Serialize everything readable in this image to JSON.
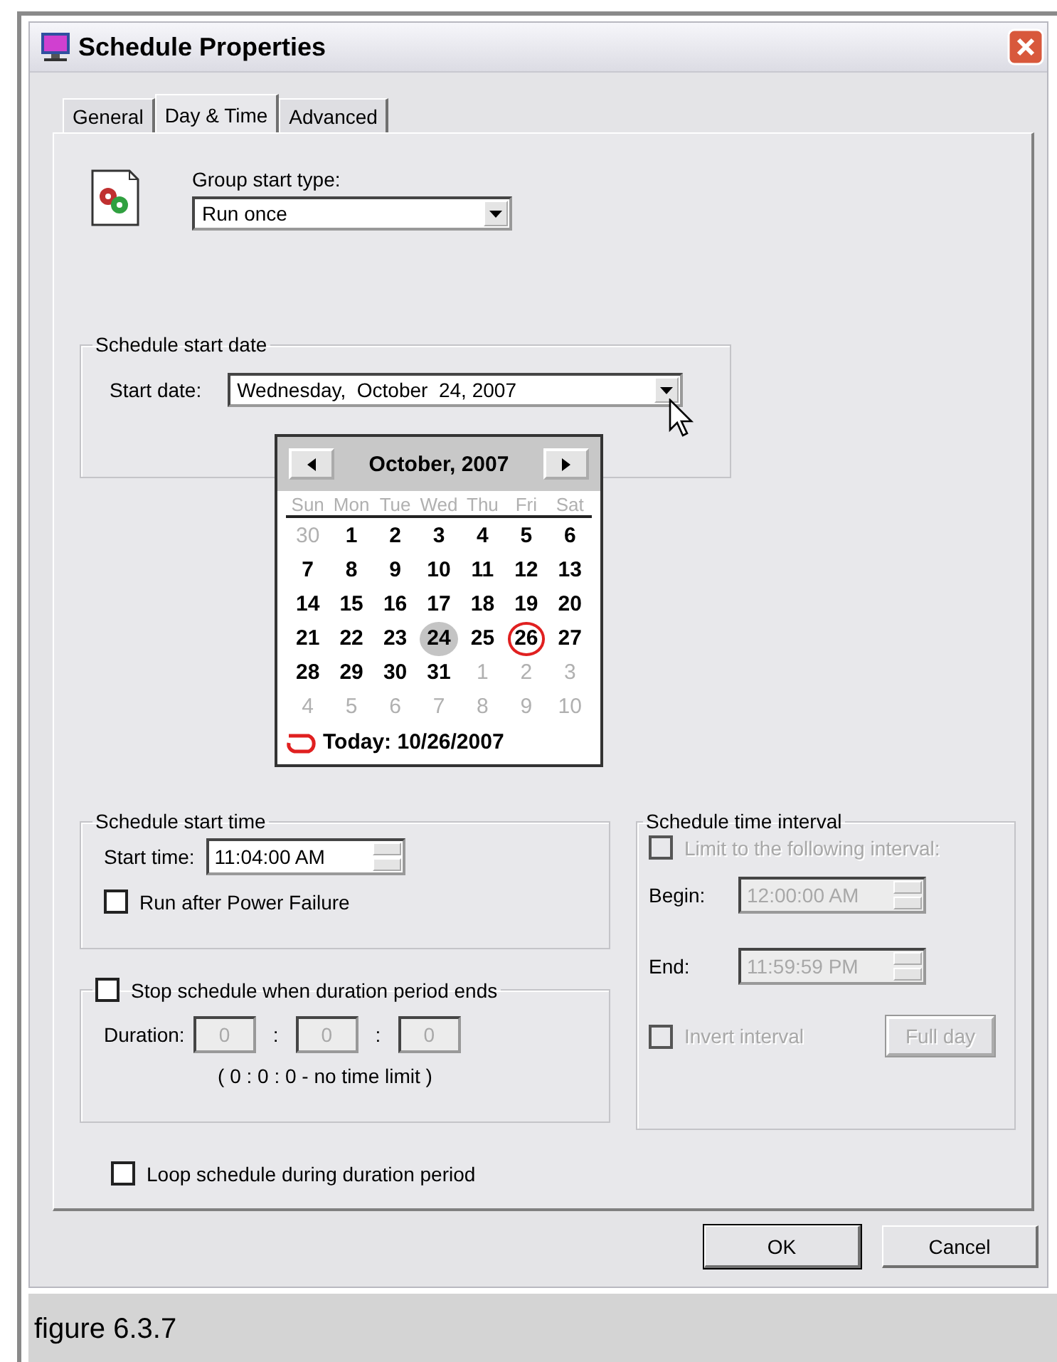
{
  "window": {
    "title": "Schedule Properties"
  },
  "tabs": [
    {
      "label": "General",
      "selected": false
    },
    {
      "label": "Day & Time",
      "selected": true
    },
    {
      "label": "Advanced",
      "selected": false
    }
  ],
  "group_start_type": {
    "label": "Group start type:",
    "value": "Run once"
  },
  "start_date_group": {
    "title": "Schedule start date",
    "label": "Start date:",
    "value": "Wednesday,  October  24, 2007"
  },
  "calendar": {
    "month": "October, 2007",
    "weekdays": [
      "Sun",
      "Mon",
      "Tue",
      "Wed",
      "Thu",
      "Fri",
      "Sat"
    ],
    "weeks": [
      [
        {
          "day": "30",
          "muted": true,
          "selected": false,
          "circled": false
        },
        {
          "day": "1",
          "muted": false,
          "selected": false,
          "circled": false
        },
        {
          "day": "2",
          "muted": false,
          "selected": false,
          "circled": false
        },
        {
          "day": "3",
          "muted": false,
          "selected": false,
          "circled": false
        },
        {
          "day": "4",
          "muted": false,
          "selected": false,
          "circled": false
        },
        {
          "day": "5",
          "muted": false,
          "selected": false,
          "circled": false
        },
        {
          "day": "6",
          "muted": false,
          "selected": false,
          "circled": false
        }
      ],
      [
        {
          "day": "7",
          "muted": false,
          "selected": false,
          "circled": false
        },
        {
          "day": "8",
          "muted": false,
          "selected": false,
          "circled": false
        },
        {
          "day": "9",
          "muted": false,
          "selected": false,
          "circled": false
        },
        {
          "day": "10",
          "muted": false,
          "selected": false,
          "circled": false
        },
        {
          "day": "11",
          "muted": false,
          "selected": false,
          "circled": false
        },
        {
          "day": "12",
          "muted": false,
          "selected": false,
          "circled": false
        },
        {
          "day": "13",
          "muted": false,
          "selected": false,
          "circled": false
        }
      ],
      [
        {
          "day": "14",
          "muted": false,
          "selected": false,
          "circled": false
        },
        {
          "day": "15",
          "muted": false,
          "selected": false,
          "circled": false
        },
        {
          "day": "16",
          "muted": false,
          "selected": false,
          "circled": false
        },
        {
          "day": "17",
          "muted": false,
          "selected": false,
          "circled": false
        },
        {
          "day": "18",
          "muted": false,
          "selected": false,
          "circled": false
        },
        {
          "day": "19",
          "muted": false,
          "selected": false,
          "circled": false
        },
        {
          "day": "20",
          "muted": false,
          "selected": false,
          "circled": false
        }
      ],
      [
        {
          "day": "21",
          "muted": false,
          "selected": false,
          "circled": false
        },
        {
          "day": "22",
          "muted": false,
          "selected": false,
          "circled": false
        },
        {
          "day": "23",
          "muted": false,
          "selected": false,
          "circled": false
        },
        {
          "day": "24",
          "muted": false,
          "selected": true,
          "circled": false
        },
        {
          "day": "25",
          "muted": false,
          "selected": false,
          "circled": false
        },
        {
          "day": "26",
          "muted": false,
          "selected": false,
          "circled": true
        },
        {
          "day": "27",
          "muted": false,
          "selected": false,
          "circled": false
        }
      ],
      [
        {
          "day": "28",
          "muted": false,
          "selected": false,
          "circled": false
        },
        {
          "day": "29",
          "muted": false,
          "selected": false,
          "circled": false
        },
        {
          "day": "30",
          "muted": false,
          "selected": false,
          "circled": false
        },
        {
          "day": "31",
          "muted": false,
          "selected": false,
          "circled": false
        },
        {
          "day": "1",
          "muted": true,
          "selected": false,
          "circled": false
        },
        {
          "day": "2",
          "muted": true,
          "selected": false,
          "circled": false
        },
        {
          "day": "3",
          "muted": true,
          "selected": false,
          "circled": false
        }
      ],
      [
        {
          "day": "4",
          "muted": true,
          "selected": false,
          "circled": false
        },
        {
          "day": "5",
          "muted": true,
          "selected": false,
          "circled": false
        },
        {
          "day": "6",
          "muted": true,
          "selected": false,
          "circled": false
        },
        {
          "day": "7",
          "muted": true,
          "selected": false,
          "circled": false
        },
        {
          "day": "8",
          "muted": true,
          "selected": false,
          "circled": false
        },
        {
          "day": "9",
          "muted": true,
          "selected": false,
          "circled": false
        },
        {
          "day": "10",
          "muted": true,
          "selected": false,
          "circled": false
        }
      ]
    ],
    "today": "Today: 10/26/2007"
  },
  "start_time_group": {
    "title": "Schedule start time",
    "label": "Start time:",
    "value": "11:04:00 AM",
    "checkbox": {
      "label": "Run after Power Failure",
      "checked": false
    }
  },
  "duration_group": {
    "checkbox": {
      "label": "Stop schedule when duration period ends",
      "checked": false
    },
    "label": "Duration:",
    "fields": [
      {
        "value": "0",
        "disabled": true
      },
      {
        "value": "0",
        "disabled": true
      },
      {
        "value": "0",
        "disabled": true
      }
    ],
    "separators": [
      ":",
      ":"
    ],
    "note": "( 0 : 0 : 0 - no time limit )"
  },
  "loop": {
    "label": "Loop schedule during duration period",
    "checked": false
  },
  "interval_group": {
    "title": "Schedule time interval",
    "limit": {
      "label": "Limit to the following interval:",
      "checked": false,
      "disabled": true
    },
    "begin": {
      "label": "Begin:",
      "value": "12:00:00 AM",
      "disabled": true
    },
    "end": {
      "label": "End:",
      "value": "11:59:59 PM",
      "disabled": true
    },
    "invert": {
      "label": "Invert interval",
      "checked": false,
      "disabled": true
    },
    "full_day": {
      "label": "Full day",
      "disabled": true
    }
  },
  "buttons": [
    {
      "label": "OK",
      "default": true
    },
    {
      "label": "Cancel",
      "default": false
    }
  ],
  "caption": "figure 6.3.7"
}
